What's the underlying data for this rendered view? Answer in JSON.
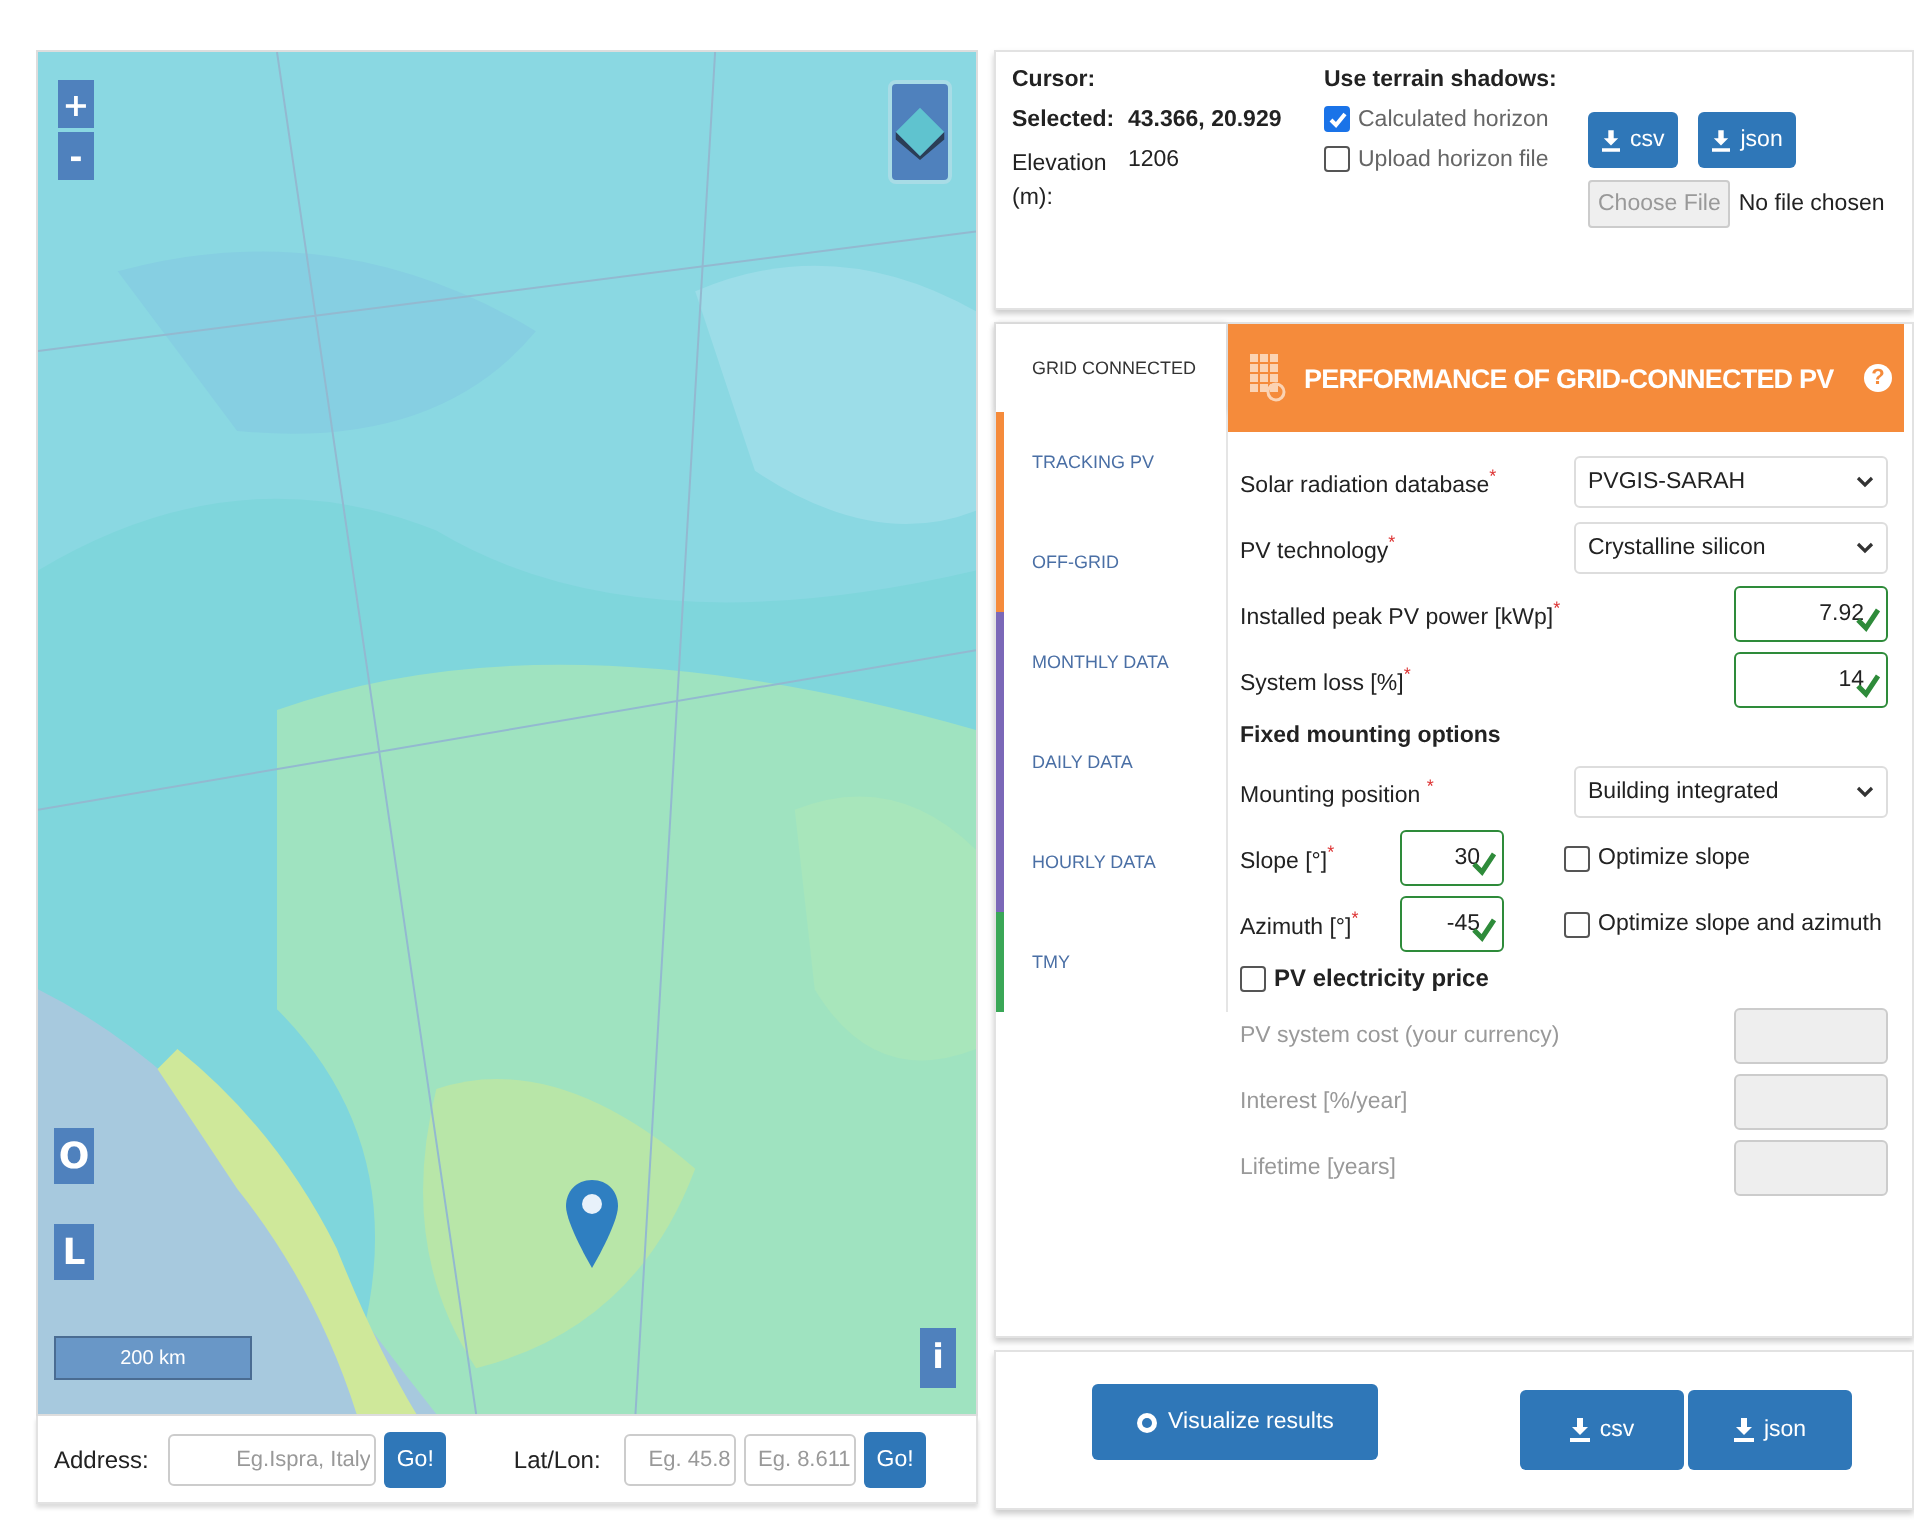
{
  "map": {
    "zoom_in": "+",
    "zoom_out": "-",
    "mode_buttons": [
      "O",
      "L"
    ],
    "scale": "200 km",
    "info": "i"
  },
  "location_bar": {
    "address_label": "Address:",
    "address_field": {
      "placeholder": "Eg.Ispra, Italy"
    },
    "address_go": "Go!",
    "latlon_label": "Lat/Lon:",
    "lat_field": {
      "placeholder": "Eg. 45.8"
    },
    "lon_field": {
      "placeholder": "Eg. 8.611"
    },
    "latlon_go": "Go!"
  },
  "info": {
    "cursor_label": "Cursor:",
    "selected_label": "Selected:",
    "selected_value": "43.366, 20.929",
    "elevation_label": "Elevation (m):",
    "elevation_value": "1206"
  },
  "terrain": {
    "title": "Use terrain shadows:",
    "options": [
      {
        "label": "Calculated horizon",
        "checked": true
      },
      {
        "label": "Upload horizon file",
        "checked": false
      }
    ]
  },
  "horizon_downloads": [
    "csv",
    "json"
  ],
  "file_input": {
    "button": "Choose File",
    "status": "No file chosen"
  },
  "tabs": [
    {
      "label": "GRID CONNECTED",
      "selected": true
    },
    {
      "label": "TRACKING PV",
      "selected": false,
      "color": "#f58b3b"
    },
    {
      "label": "OFF-GRID",
      "selected": false,
      "color": "#f58b3b"
    },
    {
      "label": "MONTHLY DATA",
      "selected": false,
      "color": "#7b68b8"
    },
    {
      "label": "DAILY DATA",
      "selected": false,
      "color": "#7b68b8"
    },
    {
      "label": "HOURLY DATA",
      "selected": false,
      "color": "#7b68b8"
    },
    {
      "label": "TMY",
      "selected": false,
      "color": "#3aa757"
    }
  ],
  "panel": {
    "title": "PERFORMANCE OF GRID-CONNECTED PV",
    "help": "?"
  },
  "fields": [
    {
      "kind": "select",
      "label": "Solar radiation database",
      "mark": "*",
      "value": "PVGIS-SARAH"
    },
    {
      "kind": "select",
      "label": "PV technology",
      "mark": "*",
      "value": "Crystalline silicon"
    },
    {
      "kind": "input",
      "label": "Installed peak PV power [kWp]",
      "mark": "*",
      "value": "7.92",
      "valid": true
    },
    {
      "kind": "input",
      "label": "System loss [%]",
      "mark": "*",
      "value": "14",
      "valid": true
    }
  ],
  "mounting": {
    "title": "Fixed mounting options",
    "position": {
      "label": "Mounting position",
      "mark": "*",
      "value": "Building integrated"
    },
    "angles": [
      {
        "label": "Slope [°]",
        "mark": "*",
        "value": "30",
        "valid": true
      },
      {
        "label": "Azimuth [°]",
        "mark": "*",
        "value": "-45",
        "valid": true
      }
    ],
    "options": [
      {
        "label": "Optimize slope",
        "checked": false
      },
      {
        "label": "Optimize slope and azimuth",
        "checked": false
      }
    ]
  },
  "price": {
    "label": "PV electricity price",
    "checked": false,
    "fields": [
      {
        "label": "PV system cost (your currency)",
        "disabled": true
      },
      {
        "label": "Interest [%/year]",
        "disabled": true
      },
      {
        "label": "Lifetime [years]",
        "disabled": true
      }
    ]
  },
  "actions": {
    "visualize": "Visualize results",
    "downloads": [
      "csv",
      "json"
    ]
  }
}
